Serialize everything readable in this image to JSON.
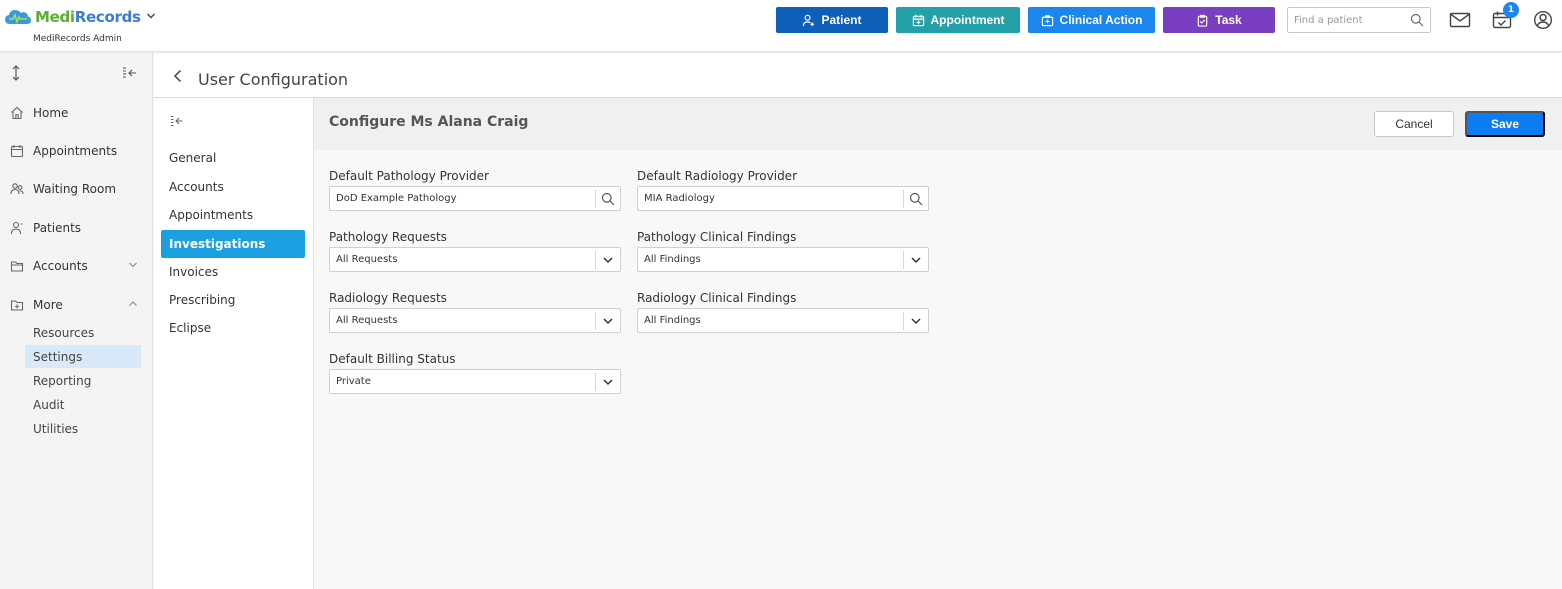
{
  "app": {
    "name_part1": "Medi",
    "name_part2": "Records",
    "subtitle": "MediRecords Admin"
  },
  "topbar": {
    "buttons": {
      "patient": "Patient",
      "appointment": "Appointment",
      "clinical_action": "Clinical Action",
      "task": "Task"
    },
    "search_placeholder": "Find a patient",
    "notification_count": "1"
  },
  "sidebar": {
    "items": [
      {
        "label": "Home"
      },
      {
        "label": "Appointments"
      },
      {
        "label": "Waiting Room"
      },
      {
        "label": "Patients"
      },
      {
        "label": "Accounts"
      },
      {
        "label": "More"
      }
    ],
    "more_items": [
      {
        "label": "Resources"
      },
      {
        "label": "Settings"
      },
      {
        "label": "Reporting"
      },
      {
        "label": "Audit"
      },
      {
        "label": "Utilities"
      }
    ],
    "active_item": "Settings"
  },
  "page": {
    "title": "User Configuration"
  },
  "subnav": {
    "items": [
      {
        "label": "General"
      },
      {
        "label": "Accounts"
      },
      {
        "label": "Appointments"
      },
      {
        "label": "Investigations"
      },
      {
        "label": "Invoices"
      },
      {
        "label": "Prescribing"
      },
      {
        "label": "Eclipse"
      }
    ],
    "active_item": "Investigations"
  },
  "form": {
    "title": "Configure Ms Alana Craig",
    "cancel_label": "Cancel",
    "save_label": "Save",
    "fields": {
      "default_pathology_provider": {
        "label": "Default Pathology Provider",
        "value": "DoD Example Pathology"
      },
      "default_radiology_provider": {
        "label": "Default Radiology Provider",
        "value": "MIA Radiology"
      },
      "pathology_requests": {
        "label": "Pathology Requests",
        "value": "All Requests"
      },
      "pathology_clinical_findings": {
        "label": "Pathology Clinical Findings",
        "value": "All Findings"
      },
      "radiology_requests": {
        "label": "Radiology Requests",
        "value": "All Requests"
      },
      "radiology_clinical_findings": {
        "label": "Radiology Clinical Findings",
        "value": "All Findings"
      },
      "default_billing_status": {
        "label": "Default Billing Status",
        "value": "Private"
      }
    }
  },
  "colors": {
    "patient_btn": "#0d5fb8",
    "appointment_btn": "#23a0a8",
    "clinical_btn": "#1a86ee",
    "task_btn": "#7a3fc0",
    "active_subnav": "#1ba1e2",
    "save_btn": "#0b7cf2",
    "active_sidebar": "#d9e9f9"
  },
  "icons": {
    "logo": "cloud-logo-icon",
    "patient": "add-person-icon",
    "appointment": "calendar-plus-icon",
    "clinical_action": "medical-case-icon",
    "task": "clipboard-icon",
    "mail": "mail-icon",
    "calendar_check": "calendar-check-icon",
    "user": "user-circle-icon"
  }
}
